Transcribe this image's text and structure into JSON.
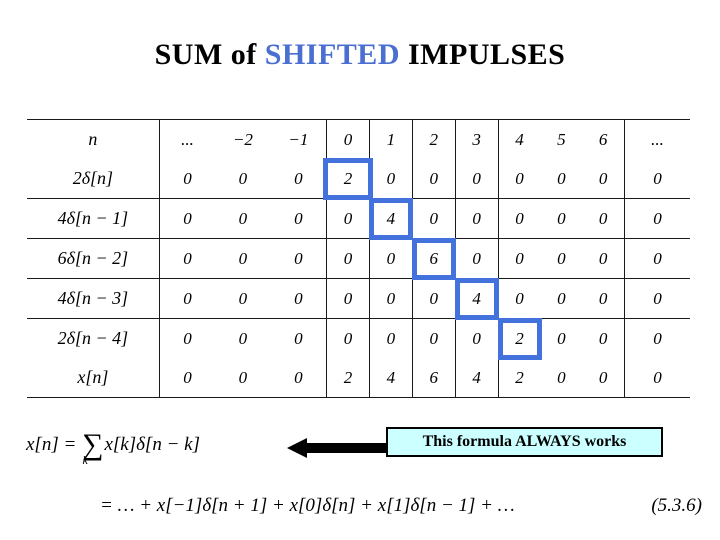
{
  "title": {
    "part1": "SUM of ",
    "highlight": "SHIFTED",
    "part2": " IMPULSES",
    "highlight_color": "#4a6fd0"
  },
  "table": {
    "highlight_color": "#4472dd",
    "header": {
      "label": "n",
      "values": [
        "...",
        "−2",
        "−1",
        "0",
        "1",
        "2",
        "3",
        "4",
        "5",
        "6",
        "..."
      ]
    },
    "rows": [
      {
        "label": "2δ[n]",
        "values": [
          "0",
          "0",
          "0",
          "2",
          "0",
          "0",
          "0",
          "0",
          "0",
          "0",
          "0"
        ],
        "highlight_index": 3
      },
      {
        "label": "4δ[n − 1]",
        "values": [
          "0",
          "0",
          "0",
          "0",
          "4",
          "0",
          "0",
          "0",
          "0",
          "0",
          "0"
        ],
        "highlight_index": 4
      },
      {
        "label": "6δ[n − 2]",
        "values": [
          "0",
          "0",
          "0",
          "0",
          "0",
          "6",
          "0",
          "0",
          "0",
          "0",
          "0"
        ],
        "highlight_index": 5
      },
      {
        "label": "4δ[n − 3]",
        "values": [
          "0",
          "0",
          "0",
          "0",
          "0",
          "0",
          "4",
          "0",
          "0",
          "0",
          "0"
        ],
        "highlight_index": 6
      },
      {
        "label": "2δ[n − 4]",
        "values": [
          "0",
          "0",
          "0",
          "0",
          "0",
          "0",
          "0",
          "2",
          "0",
          "0",
          "0"
        ],
        "highlight_index": 7
      },
      {
        "label": "x[n]",
        "values": [
          "0",
          "0",
          "0",
          "2",
          "4",
          "6",
          "4",
          "2",
          "0",
          "0",
          "0"
        ],
        "highlight_index": -1
      }
    ]
  },
  "formula": {
    "sum_lhs": "x[n]  =  ",
    "sum_sigma": "∑",
    "sum_subscript": "k",
    "sum_rhs": "x[k]δ[n − k]",
    "expanded": "=  …  +  x[−1]δ[n + 1]  +  x[0]δ[n]  +  x[1]δ[n − 1]  +  …",
    "equation_number": "(5.3.6)"
  },
  "callout": {
    "text": "This formula ALWAYS works",
    "background": "#ccffff",
    "border": "#000000"
  }
}
